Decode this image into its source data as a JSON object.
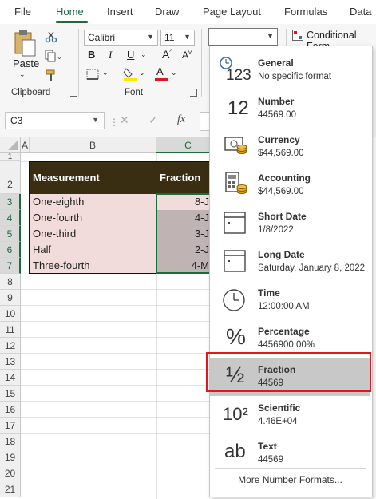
{
  "ribbon_tabs": [
    "File",
    "Home",
    "Insert",
    "Draw",
    "Page Layout",
    "Formulas",
    "Data"
  ],
  "ribbon": {
    "clipboard_label": "Clipboard",
    "paste_label": "Paste",
    "font_label": "Font",
    "font_name": "Calibri",
    "font_size": "11",
    "number_format_value": "",
    "conditional_formatting": "Conditional Form"
  },
  "formula_bar": {
    "name_box": "C3",
    "fx": "fx"
  },
  "columns": [
    "A",
    "B",
    "C"
  ],
  "rows": [
    "1",
    "2",
    "3",
    "4",
    "5",
    "6",
    "7",
    "8",
    "9",
    "10",
    "11",
    "12",
    "13",
    "14",
    "15",
    "16",
    "17",
    "18",
    "19",
    "20",
    "21"
  ],
  "table": {
    "header": [
      "Measurement",
      "Fraction"
    ],
    "rows": [
      {
        "measurement": "One-eighth",
        "fraction": "8-J"
      },
      {
        "measurement": "One-fourth",
        "fraction": "4-J"
      },
      {
        "measurement": "One-third",
        "fraction": "3-J"
      },
      {
        "measurement": "Half",
        "fraction": "2-J"
      },
      {
        "measurement": "Three-fourth",
        "fraction": "4-M"
      }
    ]
  },
  "number_formats": [
    {
      "name": "General",
      "sample": "No specific format",
      "icon": "clock-123-icon",
      "glyph": "123"
    },
    {
      "name": "Number",
      "sample": "44569.00",
      "icon": "number-12-icon",
      "glyph": "12"
    },
    {
      "name": "Currency",
      "sample": "$44,569.00",
      "icon": "currency-icon",
      "glyph": ""
    },
    {
      "name": "Accounting",
      "sample": " $44,569.00",
      "icon": "accounting-calculator-icon",
      "glyph": ""
    },
    {
      "name": "Short Date",
      "sample": "1/8/2022",
      "icon": "calendar-icon",
      "glyph": ""
    },
    {
      "name": "Long Date",
      "sample": "Saturday, January 8, 2022",
      "icon": "calendar-icon",
      "glyph": ""
    },
    {
      "name": "Time",
      "sample": "12:00:00 AM",
      "icon": "clock-icon",
      "glyph": ""
    },
    {
      "name": "Percentage",
      "sample": "4456900.00%",
      "icon": "percent-icon",
      "glyph": "%"
    },
    {
      "name": "Fraction",
      "sample": "44569",
      "icon": "fraction-icon",
      "glyph": "½"
    },
    {
      "name": "Scientific",
      "sample": "4.46E+04",
      "icon": "scientific-icon",
      "glyph": "10²"
    },
    {
      "name": "Text",
      "sample": "44569",
      "icon": "text-ab-icon",
      "glyph": "ab"
    }
  ],
  "more_formats": "More Number Formats...",
  "highlighted_format": "Fraction",
  "colors": {
    "accent_green": "#1e6b3a",
    "table_header_bg": "#3a2e12",
    "row_fill": "#f2dcdb",
    "fraction_fill": "#bfb3b3",
    "highlight_red": "#e0181e"
  }
}
